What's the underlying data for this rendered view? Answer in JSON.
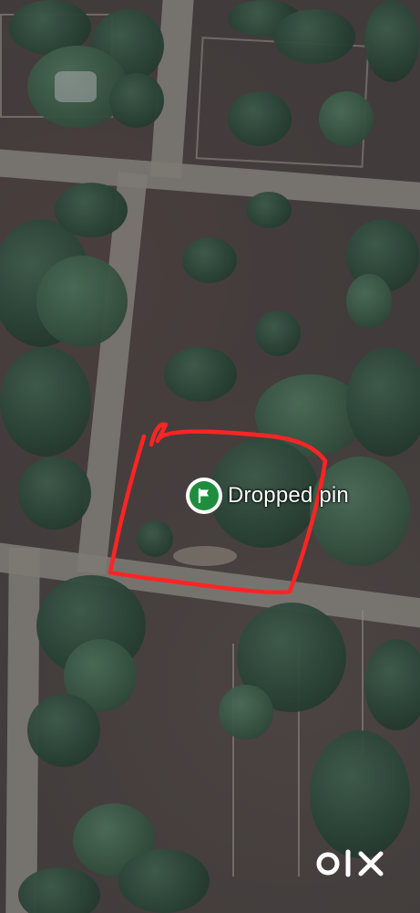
{
  "map": {
    "type": "satellite",
    "pin": {
      "label": "Dropped pin",
      "icon": "flag-icon",
      "color": "#1e8e3e"
    },
    "marked_area_outline_color": "#ff2424"
  },
  "watermark": {
    "text": "OLX",
    "color": "#ffffff"
  }
}
